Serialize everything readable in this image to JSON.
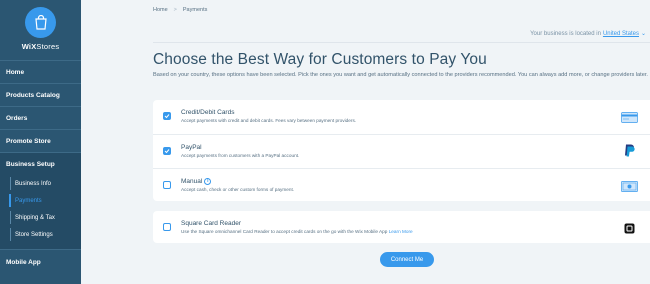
{
  "brand": {
    "name_bold": "WiX",
    "name_light": "Stores"
  },
  "nav": {
    "home": "Home",
    "products": "Products Catalog",
    "orders": "Orders",
    "promote": "Promote Store",
    "business_setup": "Business Setup",
    "sub_items": [
      "Business Info",
      "Payments",
      "Shipping & Tax",
      "Store Settings"
    ],
    "mobile": "Mobile App"
  },
  "breadcrumb": {
    "home": "Home",
    "sep": ">",
    "current": "Payments"
  },
  "location": {
    "prefix": "Your business is located in",
    "country": "United States"
  },
  "page": {
    "title": "Choose the Best Way for Customers to Pay You",
    "intro": "Based on your country, these options have been selected. Pick the ones you want and get automatically connected to the providers recommended. You can always add more, or change providers later."
  },
  "options": [
    {
      "title": "Credit/Debit Cards",
      "desc": "Accept payments with credit and debit cards. Fees vary between payment providers.",
      "checked": true,
      "icon": "credit-card-icon"
    },
    {
      "title": "PayPal",
      "desc": "Accept payments from customers with a PayPal account.",
      "checked": true,
      "icon": "paypal-icon"
    },
    {
      "title": "Manual",
      "desc": "Accept cash, check or other custom forms of payment.",
      "checked": false,
      "icon": "cash-icon"
    }
  ],
  "square": {
    "title": "Square Card Reader",
    "desc": "Use the Square omnichannel Card Reader to accept credit cards on the go with the Wix Mobile App",
    "link": "Learn More",
    "checked": false,
    "icon": "square-icon"
  },
  "connect_label": "Connect Me",
  "colors": {
    "sidebar": "#2b5672",
    "accent": "#3899ec",
    "background": "#f0f4f7"
  }
}
